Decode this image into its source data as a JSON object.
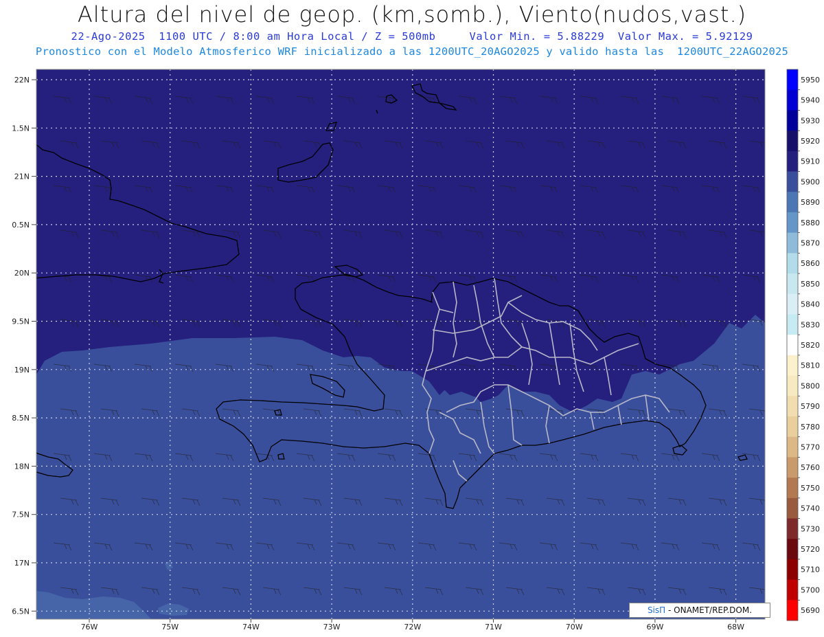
{
  "header": {
    "title": "Altura del nivel de geop. (km,somb.), Viento(nudos,vast.)",
    "line1": "22-Ago-2025  1100 UTC / 8:00 am Hora Local / Z = 500mb     Valor Min. = 5.88229  Valor Max. = 5.92129",
    "line2": "Pronostico con el Modelo Atmosferico WRF inicializado a las 1200UTC_20AGO2025 y valido hasta las  1200UTC_22AGO2025"
  },
  "map": {
    "lat_labels": [
      "22N",
      "1.5N",
      "21N",
      "0.5N",
      "20N",
      "9.5N",
      "19N",
      "8.5N",
      "18N",
      "7.5N",
      "17N",
      "6.5N"
    ],
    "lon_labels": [
      "76W",
      "75W",
      "74W",
      "73W",
      "72W",
      "71W",
      "70W",
      "69W",
      "68W"
    ],
    "fill_colors": {
      "high": "#251f7e",
      "mid": "#3a4f9c",
      "low": "#4665a8"
    }
  },
  "colorbar": {
    "levels": [
      {
        "label": "5950",
        "color": "#0000ff"
      },
      {
        "label": "5940",
        "color": "#0000d2"
      },
      {
        "label": "5930",
        "color": "#00009a"
      },
      {
        "label": "5920",
        "color": "#16106a"
      },
      {
        "label": "5910",
        "color": "#251f7e"
      },
      {
        "label": "5900",
        "color": "#3a4f9c"
      },
      {
        "label": "5890",
        "color": "#4c77b4"
      },
      {
        "label": "5880",
        "color": "#6497c8"
      },
      {
        "label": "5870",
        "color": "#8fbbdb"
      },
      {
        "label": "5860",
        "color": "#b3dcea"
      },
      {
        "label": "5850",
        "color": "#c8e8f0"
      },
      {
        "label": "5840",
        "color": "#d9eff5"
      },
      {
        "label": "5830",
        "color": "#c7ebf2"
      },
      {
        "label": "5820",
        "color": "#ffffff"
      },
      {
        "label": "5810",
        "color": "#fbf1cc"
      },
      {
        "label": "5800",
        "color": "#f7e9c0"
      },
      {
        "label": "5790",
        "color": "#f1ddb0"
      },
      {
        "label": "5780",
        "color": "#e9cf9c"
      },
      {
        "label": "5770",
        "color": "#dcb886"
      },
      {
        "label": "5760",
        "color": "#c99a6b"
      },
      {
        "label": "5750",
        "color": "#b37a52"
      },
      {
        "label": "5740",
        "color": "#995a3f"
      },
      {
        "label": "5730",
        "color": "#7f2a2a"
      },
      {
        "label": "5720",
        "color": "#6a0a0f"
      },
      {
        "label": "5710",
        "color": "#8c0000"
      },
      {
        "label": "5700",
        "color": "#c00000"
      },
      {
        "label": "5690",
        "color": "#ff0000"
      }
    ]
  },
  "credit": {
    "brand": "SisΠ",
    "text": "- ONAMET/REP.DOM."
  }
}
